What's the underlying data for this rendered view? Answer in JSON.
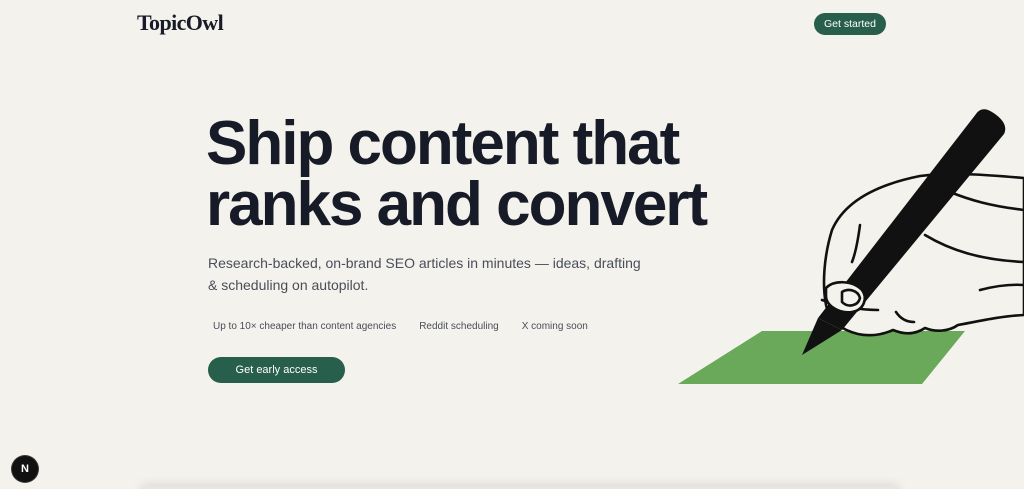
{
  "header": {
    "logo": "TopicOwl",
    "cta_label": "Get started"
  },
  "hero": {
    "headline_line1": "Ship content that",
    "headline_line2": "ranks and convert",
    "subheading": "Research-backed, on-brand SEO articles in minutes — ideas, drafting & scheduling on autopilot.",
    "features": [
      "Up to 10× cheaper than content agencies",
      "Reddit scheduling",
      "X coming soon"
    ],
    "cta_label": "Get early access",
    "illustration": "hand-writing-pen-icon"
  },
  "dev_badge": {
    "label": "N",
    "icon": "nextjs-icon"
  },
  "colors": {
    "background": "#f4f2ec",
    "brand": "#285f4c",
    "text": "#171a27",
    "paper": "#6aa85a"
  }
}
